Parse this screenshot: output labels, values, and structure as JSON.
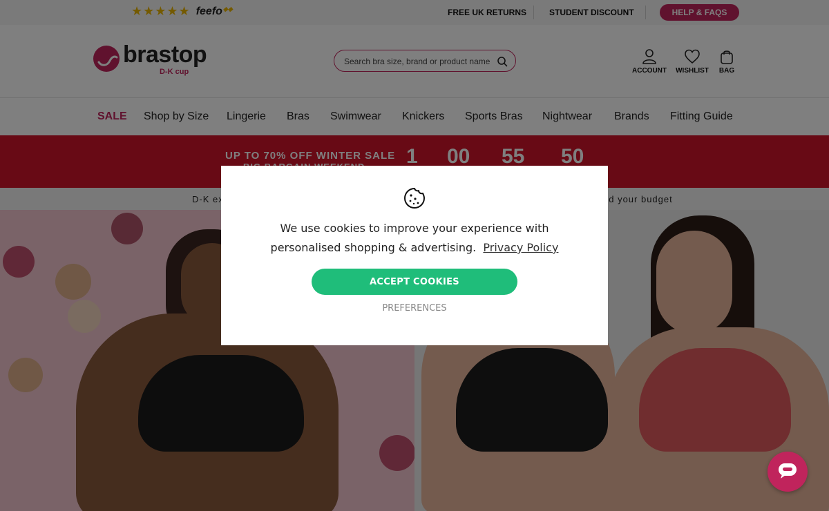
{
  "topbar": {
    "rating_stars": "★★★★★",
    "feefo_label": "feefo",
    "links": [
      "FREE UK RETURNS",
      "STUDENT DISCOUNT"
    ],
    "help_label": "HELP & FAQS"
  },
  "header": {
    "logo_word": "brastop",
    "logo_sub": "D-K cup",
    "search_placeholder": "Search bra size, brand or product name",
    "account_label": "ACCOUNT",
    "wishlist_label": "WISHLIST",
    "bag_label": "BAG"
  },
  "nav": {
    "items": [
      "SALE",
      "Shop by Size",
      "Lingerie",
      "Bras",
      "Swimwear",
      "Knickers",
      "Sports Bras",
      "Nightwear",
      "Brands",
      "Fitting Guide"
    ]
  },
  "banner": {
    "title": "UP TO 70% OFF WINTER SALE",
    "subtitle": "BIG BARGAIN WEEKEND",
    "countdown": [
      "1",
      "00",
      "55",
      "50"
    ]
  },
  "strap": {
    "left": "D-K ex",
    "right": "nd your budget"
  },
  "cookie_modal": {
    "text": "We use cookies to improve your experience with personalised shopping & advertising.",
    "privacy_link": "Privacy Policy",
    "accept_label": "ACCEPT COOKIES",
    "preferences_label": "PREFERENCES"
  },
  "colors": {
    "brand": "#c0245c",
    "banner": "#d0142a",
    "accept": "#1fbd7a"
  }
}
